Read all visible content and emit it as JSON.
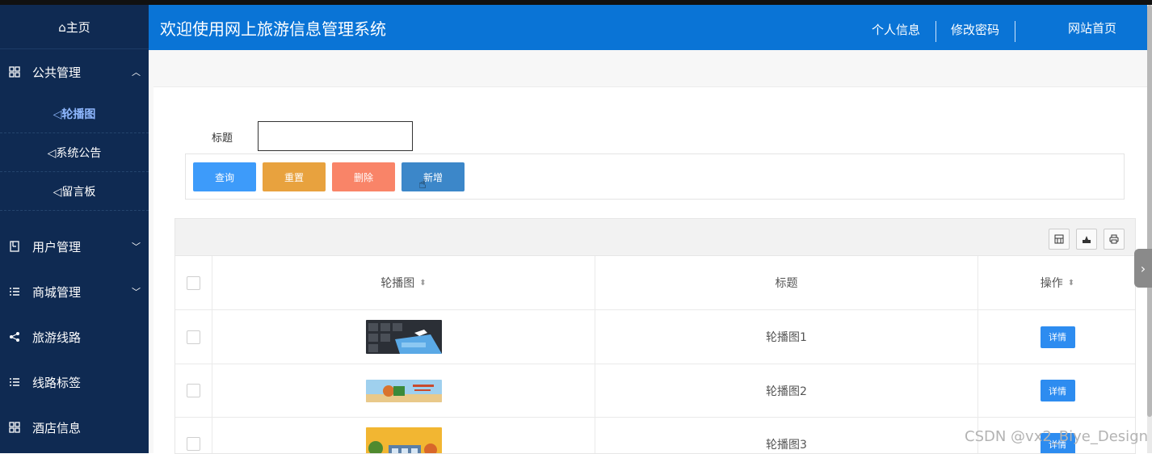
{
  "sidebar": {
    "home_label": "⌂主页",
    "groups": [
      {
        "label": "公共管理",
        "icon": "grid-icon",
        "expanded": true,
        "children": [
          {
            "label": "◁轮播图",
            "active": true
          },
          {
            "label": "◁系统公告",
            "active": false
          },
          {
            "label": "◁留言板",
            "active": false
          }
        ]
      },
      {
        "label": "用户管理",
        "icon": "book-icon",
        "chevron": "down"
      },
      {
        "label": "商城管理",
        "icon": "list-icon",
        "chevron": "down"
      },
      {
        "label": "旅游线路",
        "icon": "share-icon"
      },
      {
        "label": "线路标签",
        "icon": "list-icon"
      },
      {
        "label": "酒店信息",
        "icon": "grid-icon"
      }
    ]
  },
  "header": {
    "title": "欢迎使用网上旅游信息管理系统",
    "nav": [
      "个人信息",
      "修改密码",
      "网站首页"
    ]
  },
  "search": {
    "label": "标题",
    "value": "",
    "placeholder": ""
  },
  "buttons": {
    "query": "查询",
    "reset": "重置",
    "delete": "删除",
    "add": "新增"
  },
  "colors": {
    "sidebar_bg": "#0f2a52",
    "header_bg": "#0a74d6",
    "query": "#3d9bfa",
    "reset": "#e8a23e",
    "delete": "#f98468",
    "add": "#3c87c9",
    "detail": "#2d8cf0"
  },
  "table": {
    "toolbar_icons": [
      "columns-icon",
      "export-icon",
      "print-icon"
    ],
    "columns": [
      "轮播图",
      "标题",
      "操作"
    ],
    "rows": [
      {
        "title": "轮播图1",
        "action": "详情",
        "thumb": "travel-keyboard-image"
      },
      {
        "title": "轮播图2",
        "action": "详情",
        "thumb": "travel-banner-image"
      },
      {
        "title": "轮播图3",
        "action": "详情",
        "thumb": "autumn-scene-image"
      }
    ]
  },
  "watermark": "CSDN @vx2_Biye_Design"
}
